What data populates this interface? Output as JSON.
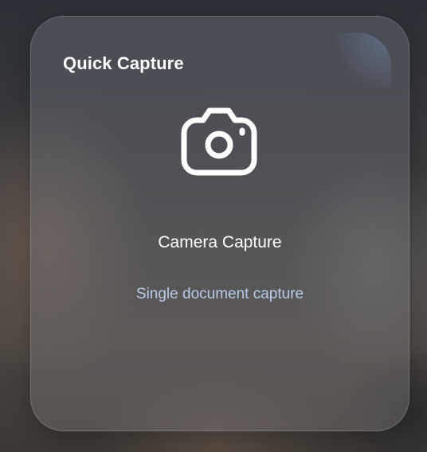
{
  "widget": {
    "title": "Quick Capture",
    "icon": "camera-icon",
    "action_label": "Camera Capture",
    "action_description": "Single document capture"
  },
  "colors": {
    "title_text": "#ffffff",
    "description_text": "#b9cbea"
  }
}
